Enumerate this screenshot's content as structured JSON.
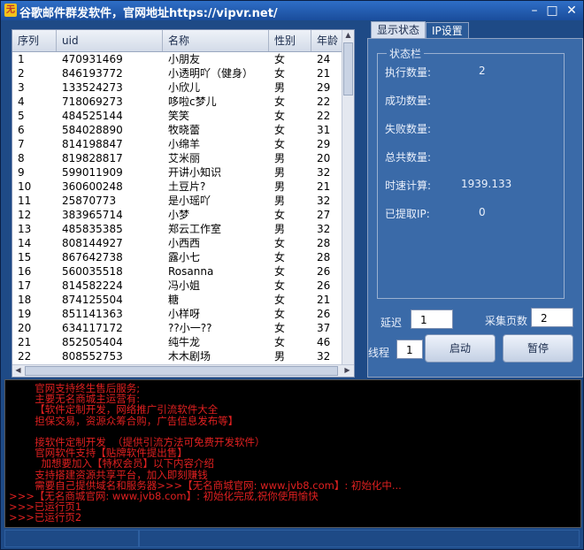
{
  "window": {
    "title": "谷歌邮件群发软件，官网地址https://vipvr.net/",
    "minimize_glyph": "–",
    "maximize_glyph": "□",
    "close_glyph": "✕"
  },
  "list": {
    "columns": [
      "序列",
      "uid",
      "名称",
      "性别",
      "年龄"
    ],
    "rows": [
      [
        "1",
        "470931469",
        "小朋友",
        "女",
        "24"
      ],
      [
        "2",
        "846193772",
        "小透明吖（健身）",
        "女",
        "21"
      ],
      [
        "3",
        "133524273",
        "小欣儿",
        "男",
        "29"
      ],
      [
        "4",
        "718069273",
        "哆啦c梦儿",
        "女",
        "22"
      ],
      [
        "5",
        "484525144",
        "笑笑",
        "女",
        "22"
      ],
      [
        "6",
        "584028890",
        "牧晓蕾",
        "女",
        "31"
      ],
      [
        "7",
        "814198847",
        "小绵羊",
        "女",
        "29"
      ],
      [
        "8",
        "819828817",
        "艾米丽",
        "男",
        "20"
      ],
      [
        "9",
        "599011909",
        "开讲小知识",
        "男",
        "32"
      ],
      [
        "10",
        "360600248",
        "土豆片?",
        "男",
        "21"
      ],
      [
        "11",
        "25870773",
        "是小瑶吖",
        "男",
        "32"
      ],
      [
        "12",
        "383965714",
        "小梦",
        "女",
        "27"
      ],
      [
        "13",
        "485835385",
        "郑云工作室",
        "男",
        "32"
      ],
      [
        "14",
        "808144927",
        "小西西",
        "女",
        "28"
      ],
      [
        "15",
        "867642738",
        "露小七",
        "女",
        "28"
      ],
      [
        "16",
        "560035518",
        "Rosanna",
        "女",
        "26"
      ],
      [
        "17",
        "814582224",
        "冯小姐",
        "女",
        "26"
      ],
      [
        "18",
        "874125504",
        "糖",
        "女",
        "21"
      ],
      [
        "19",
        "851141363",
        "小样呀",
        "女",
        "26"
      ],
      [
        "20",
        "634117172",
        "??小一??",
        "女",
        "37"
      ],
      [
        "21",
        "852505404",
        "纯牛龙",
        "女",
        "46"
      ],
      [
        "22",
        "808552753",
        "木木剧场",
        "男",
        "32"
      ]
    ]
  },
  "tabs": [
    "显示状态",
    "IP设置"
  ],
  "status": {
    "group_title": "状态栏",
    "items": [
      {
        "label": "执行数量:",
        "value": "2"
      },
      {
        "label": "成功数量:",
        "value": ""
      },
      {
        "label": "失败数量:",
        "value": ""
      },
      {
        "label": "总共数量:",
        "value": ""
      },
      {
        "label": "时速计算:",
        "value": "1939.133"
      },
      {
        "label": "已提取IP:",
        "value": "0"
      }
    ]
  },
  "controls": {
    "delay_label": "延迟",
    "delay_value": "1",
    "pages_label": "采集页数",
    "pages_value": "2",
    "threads_label": "线程",
    "threads_value": "1",
    "start_label": "启动",
    "pause_label": "暂停"
  },
  "log": {
    "lines": [
      "        官网支持终生售后服务;",
      "        主要无名商城主运营有:",
      "        【软件定制开发，网络推广引流软件大全",
      "        担保交易，资源众筹合购，广告信息发布等】",
      "",
      "        接软件定制开发  （提供引流方法可免费开发软件）",
      "        官网软件支持【贴牌软件提出售】",
      "          加想要加入【特权会员】以下内容介绍",
      "        支持搭建资源共享平台，加入即刻赚钱",
      "        需要自己提供域名和服务器>>>【无名商城官网: www.jvb8.com】: 初始化中...",
      ">>>【无名商城官网: www.jvb8.com】: 初始化完成,祝你使用愉快",
      ">>>已运行页1",
      ">>>已运行页2"
    ]
  }
}
